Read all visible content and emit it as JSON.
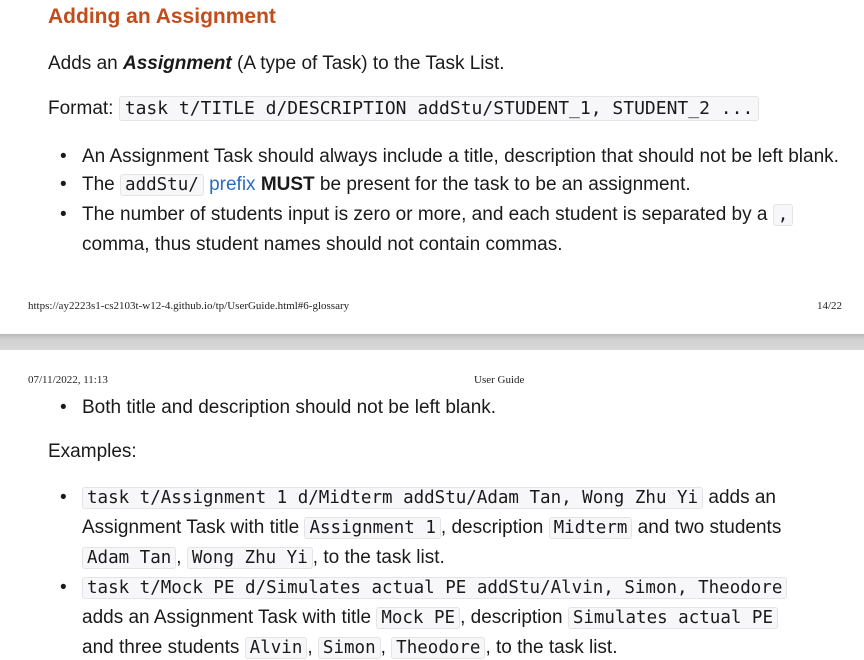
{
  "page1": {
    "heading": "Adding an Assignment",
    "intro": {
      "pre": "Adds an ",
      "term": "Assignment",
      "post": " (A type of Task) to the Task List."
    },
    "format": {
      "label": "Format: ",
      "code": "task t/TITLE d/DESCRIPTION addStu/STUDENT_1, STUDENT_2 ..."
    },
    "bullets": {
      "b1": "An Assignment Task should always include a title, description that should not be left blank.",
      "b2": {
        "pre": "The ",
        "code": "addStu/",
        "link": "prefix",
        "strong": "MUST",
        "post": " be present for the task to be an assignment."
      },
      "b3": {
        "pre": "The number of students input is zero or more, and each student is separated by a ",
        "code": ",",
        "post": "comma, thus student names should not contain commas."
      }
    },
    "footer": {
      "url": "https://ay2223s1-cs2103t-w12-4.github.io/tp/UserGuide.html#6-glossary",
      "page": "14/22"
    }
  },
  "page2": {
    "header": {
      "date": "07/11/2022, 11:13",
      "title": "User Guide"
    },
    "bullet_top": "Both title and description should not be left blank.",
    "examples_label": "Examples:",
    "ex1": {
      "cmd": "task t/Assignment 1 d/Midterm addStu/Adam Tan, Wong Zhu Yi",
      "t1": " adds an",
      "t2": "Assignment Task with title ",
      "title": "Assignment 1",
      "t3": ", description ",
      "desc": "Midterm",
      "t4": " and two students",
      "s1": "Adam Tan",
      "sep": ", ",
      "s2": "Wong Zhu Yi",
      "t5": ", to the task list."
    },
    "ex2": {
      "cmd": "task t/Mock PE d/Simulates actual PE addStu/Alvin, Simon, Theodore",
      "t1": "adds an Assignment Task with title ",
      "title": "Mock PE",
      "t2": ", description ",
      "desc": "Simulates actual PE",
      "t3": "and three students ",
      "s1": "Alvin",
      "sep1": ", ",
      "s2": "Simon",
      "sep2": ", ",
      "s3": "Theodore",
      "t4": ", to the task list."
    }
  }
}
